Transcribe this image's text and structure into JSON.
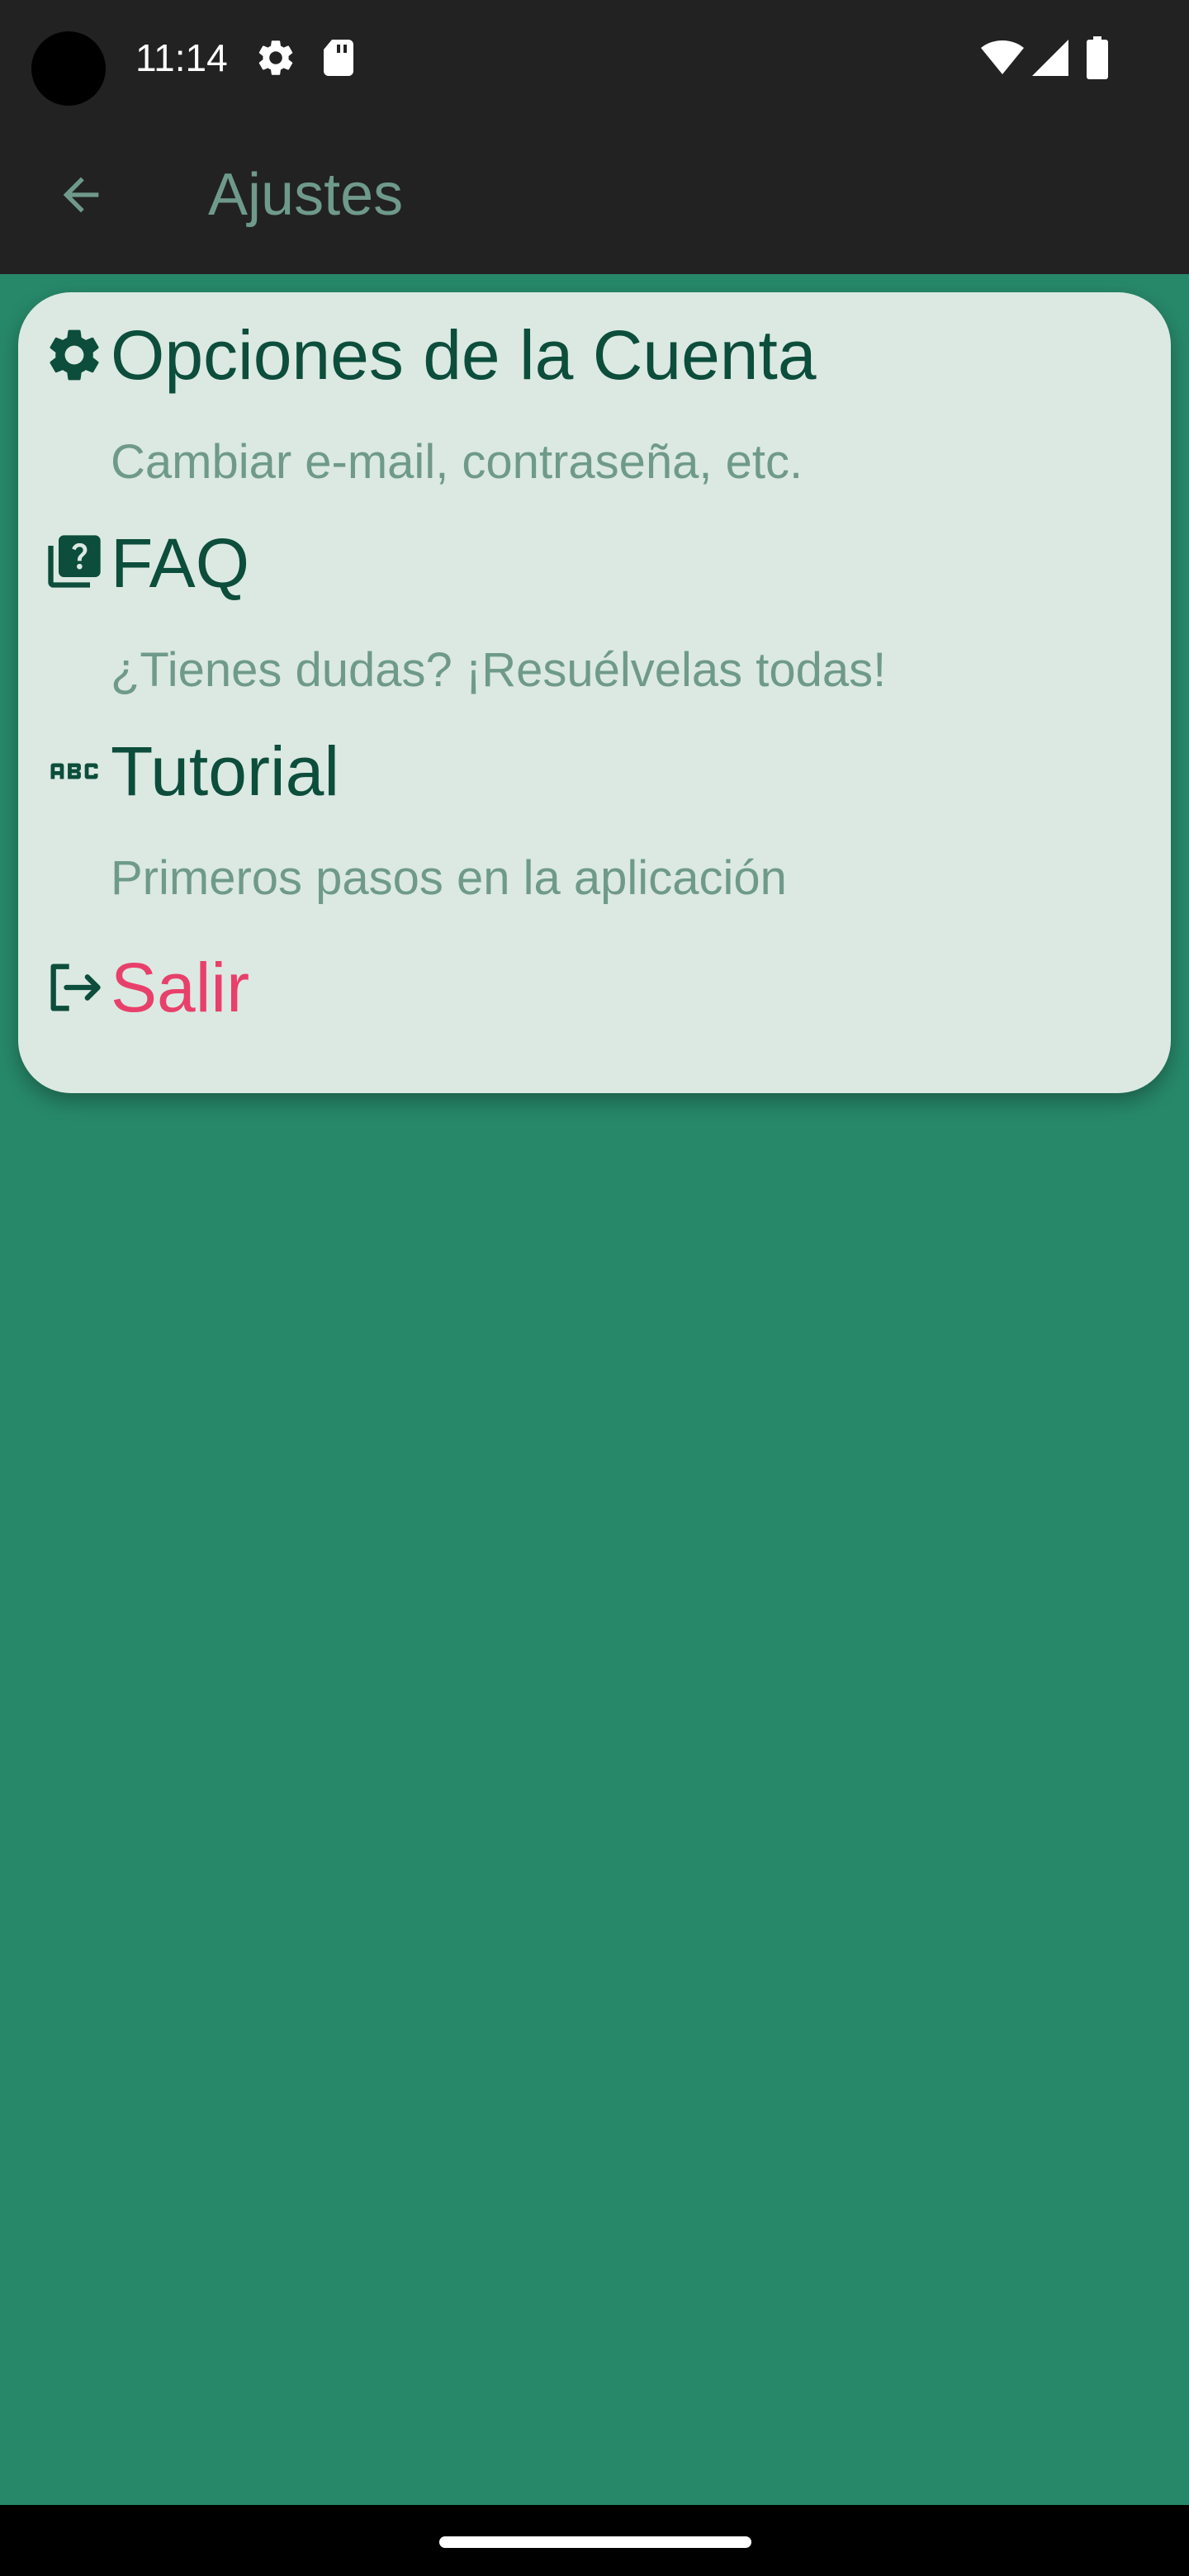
{
  "status_bar": {
    "time": "11:14",
    "icons": [
      "settings-gear-icon",
      "sd-card-icon",
      "wifi-icon",
      "signal-icon",
      "battery-icon"
    ]
  },
  "app_bar": {
    "back_icon": "arrow-back-icon",
    "title": "Ajustes"
  },
  "settings": {
    "items": [
      {
        "icon": "gear-icon",
        "title": "Opciones de la Cuenta",
        "subtitle": "Cambiar e-mail, contraseña, etc."
      },
      {
        "icon": "quiz-icon",
        "title": "FAQ",
        "subtitle": "¿Tienes dudas? ¡Resuélvelas todas!"
      },
      {
        "icon": "abc-icon",
        "title": "Tutorial",
        "subtitle": "Primeros pasos en la aplicación"
      },
      {
        "icon": "logout-icon",
        "title": "Salir"
      }
    ]
  },
  "colors": {
    "background": "#278869",
    "bar": "#222222",
    "card": "#dbe9e2",
    "title_text": "#0c4d3b",
    "subtitle_text": "#6f9a8b",
    "logout_text": "#e8406b"
  }
}
